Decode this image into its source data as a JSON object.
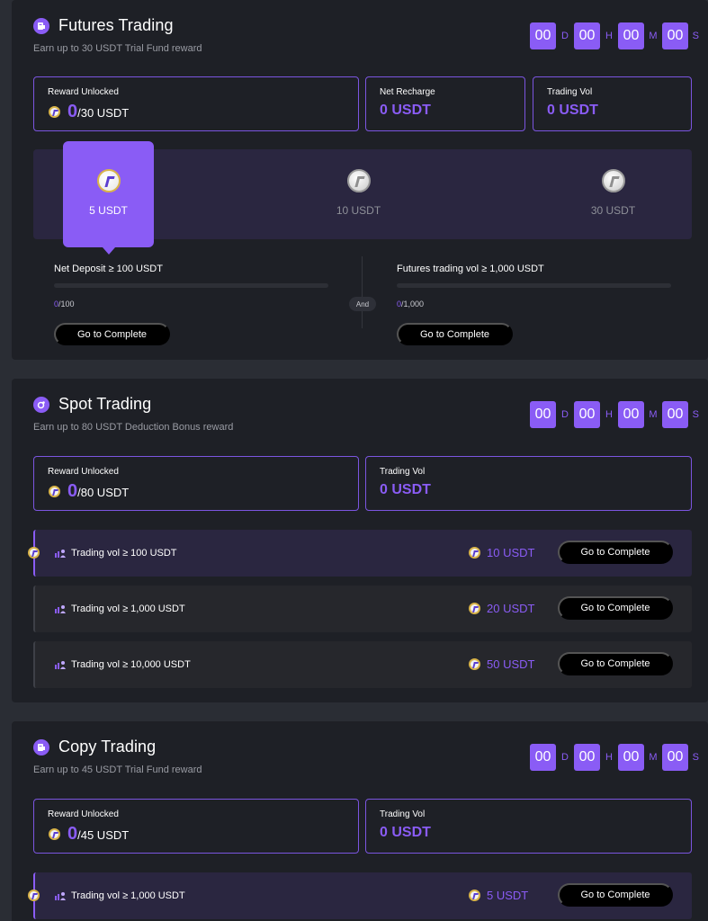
{
  "countdown": {
    "values": [
      "00",
      "00",
      "00",
      "00"
    ],
    "units": [
      "D",
      "H",
      "M",
      "S"
    ]
  },
  "futures": {
    "title": "Futures Trading",
    "subtitle": "Earn up to 30 USDT Trial Fund reward",
    "reward_label": "Reward Unlocked",
    "reward_current": "0",
    "reward_total": "/30 USDT",
    "net_recharge_label": "Net Recharge",
    "net_recharge_value": "0 USDT",
    "trading_vol_label": "Trading Vol",
    "trading_vol_value": "0 USDT",
    "tiers": [
      {
        "label": "5 USDT",
        "active": true
      },
      {
        "label": "10 USDT",
        "active": false
      },
      {
        "label": "30 USDT",
        "active": false
      }
    ],
    "req1": {
      "label": "Net Deposit ≥ 100 USDT",
      "current": "0",
      "target": "/100",
      "progress": 0,
      "button": "Go to Complete"
    },
    "and_label": "And",
    "req2": {
      "label": "Futures trading vol ≥ 1,000 USDT",
      "current": "0",
      "target": "/1,000",
      "progress": 0,
      "button": "Go to Complete"
    }
  },
  "spot": {
    "title": "Spot Trading",
    "subtitle": "Earn up to 80 USDT Deduction Bonus reward",
    "reward_label": "Reward Unlocked",
    "reward_current": "0",
    "reward_total": "/80 USDT",
    "trading_vol_label": "Trading Vol",
    "trading_vol_value": "0 USDT",
    "tasks": [
      {
        "label": "Trading vol ≥ 100 USDT",
        "reward": "10 USDT",
        "button": "Go to Complete"
      },
      {
        "label": "Trading vol ≥ 1,000 USDT",
        "reward": "20 USDT",
        "button": "Go to Complete"
      },
      {
        "label": "Trading vol ≥ 10,000 USDT",
        "reward": "50 USDT",
        "button": "Go to Complete"
      }
    ]
  },
  "copy": {
    "title": "Copy Trading",
    "subtitle": "Earn up to 45 USDT Trial Fund reward",
    "reward_label": "Reward Unlocked",
    "reward_current": "0",
    "reward_total": "/45 USDT",
    "trading_vol_label": "Trading Vol",
    "trading_vol_value": "0 USDT",
    "tasks": [
      {
        "label": "Trading vol ≥ 1,000 USDT",
        "reward": "5 USDT",
        "button": "Go to Complete"
      }
    ]
  },
  "colors": {
    "accent": "#8a5cf5",
    "card": "#1e2026",
    "page": "#2a2d34"
  }
}
